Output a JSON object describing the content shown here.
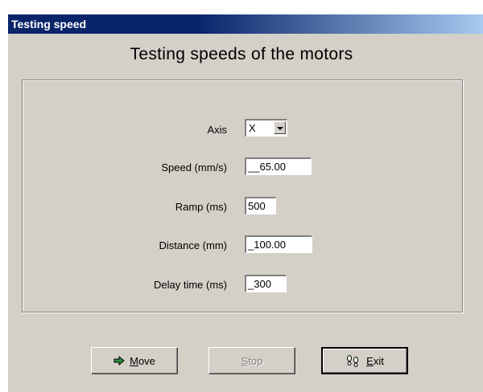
{
  "window": {
    "title": "Testing speed"
  },
  "heading": "Testing speeds of the motors",
  "form": {
    "axis": {
      "label": "Axis",
      "value": "X"
    },
    "speed": {
      "label": "Speed (mm/s)",
      "value": "__65.00"
    },
    "ramp": {
      "label": "Ramp (ms)",
      "value": "500"
    },
    "distance": {
      "label": "Distance (mm)",
      "value": "_100.00"
    },
    "delay": {
      "label": "Delay time (ms)",
      "value": "_300"
    }
  },
  "buttons": {
    "move": {
      "label_first": "M",
      "label_rest": "ove",
      "icon": "arrow-right-icon",
      "enabled": true
    },
    "stop": {
      "label_first": "S",
      "label_rest": "top",
      "enabled": false
    },
    "exit": {
      "label_first": "E",
      "label_rest": "xit",
      "icon": "footprints-icon",
      "enabled": true
    }
  },
  "colors": {
    "titlebar_start": "#0a246a",
    "titlebar_end": "#a6caf0",
    "face": "#d4d0c8",
    "icon_green": "#2e8b3a"
  }
}
